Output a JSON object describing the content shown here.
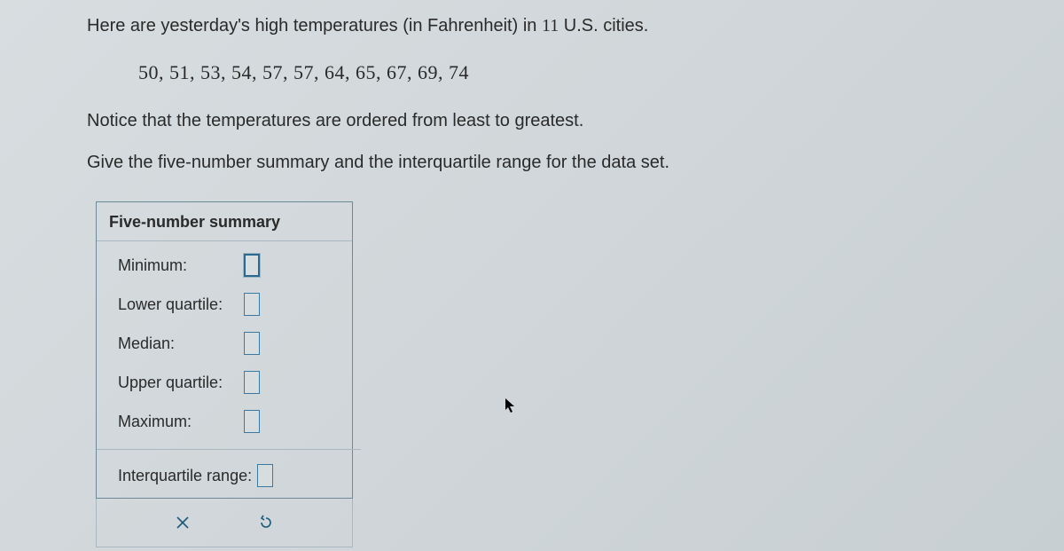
{
  "intro": {
    "prefix": "Here are yesterday's high temperatures (in Fahrenheit) in ",
    "count": "11",
    "suffix": " U.S. cities."
  },
  "data_list": "50,  51,  53,  54,  57,  57,  64,  65,  67,  69,  74",
  "note": "Notice that the temperatures are ordered from least to greatest.",
  "instruction": "Give the five-number summary and the interquartile range for the data set.",
  "summary": {
    "header": "Five-number summary",
    "rows": {
      "minimum": "Minimum:",
      "lower_quartile": "Lower quartile:",
      "median": "Median:",
      "upper_quartile": "Upper quartile:",
      "maximum": "Maximum:"
    },
    "iqr_label": "Interquartile range:"
  },
  "values": {
    "minimum": "",
    "lower_quartile": "",
    "median": "",
    "upper_quartile": "",
    "maximum": "",
    "iqr": ""
  }
}
